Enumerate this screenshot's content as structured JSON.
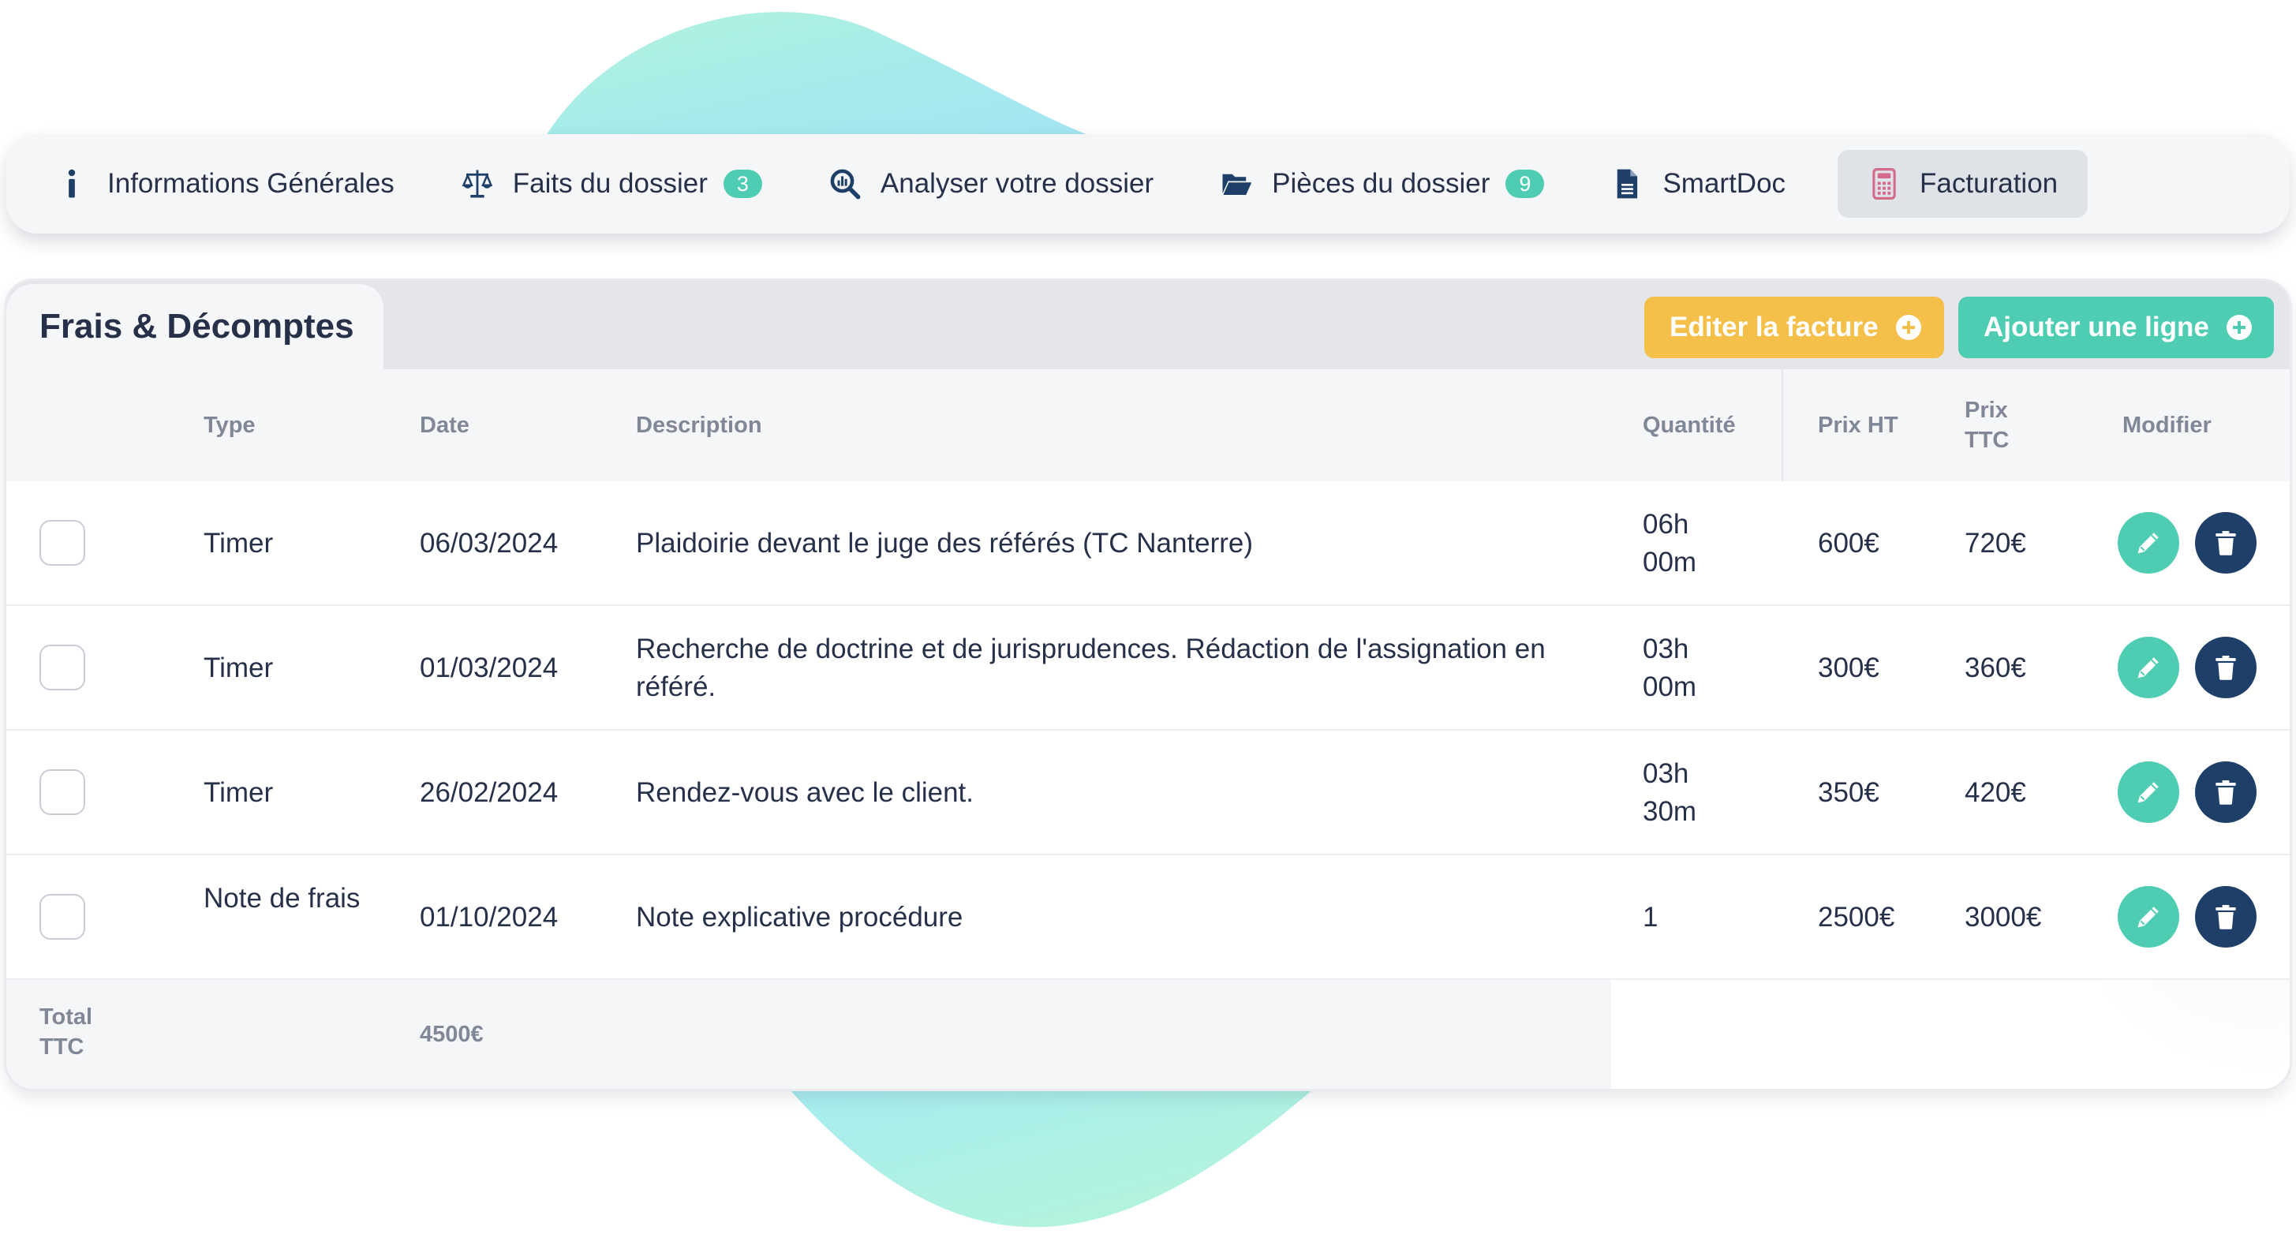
{
  "tabs": [
    {
      "label": "Informations Générales",
      "icon": "info-icon",
      "badge": ""
    },
    {
      "label": "Faits du dossier",
      "icon": "scale-icon",
      "badge": "3"
    },
    {
      "label": "Analyser votre dossier",
      "icon": "search-analytics-icon",
      "badge": ""
    },
    {
      "label": "Pièces du dossier",
      "icon": "folder-open-icon",
      "badge": "9"
    },
    {
      "label": "SmartDoc",
      "icon": "document-icon",
      "badge": ""
    },
    {
      "label": "Facturation",
      "icon": "calculator-icon",
      "badge": "",
      "active": true
    }
  ],
  "card": {
    "title": "Frais & Décomptes",
    "edit_invoice_label": "Editer la facture",
    "add_line_label": "Ajouter une ligne"
  },
  "table": {
    "headers": {
      "type": "Type",
      "date": "Date",
      "description": "Description",
      "quantity": "Quantité",
      "price_ht": "Prix HT",
      "price_ttc_1": "Prix",
      "price_ttc_2": "TTC",
      "modify": "Modifier"
    },
    "rows": [
      {
        "type": "Timer",
        "date": "06/03/2024",
        "description": "Plaidoirie devant le juge des référés (TC Nanterre)",
        "quantity_1": "06h",
        "quantity_2": "00m",
        "price_ht": "600€",
        "price_ttc": "720€"
      },
      {
        "type": "Timer",
        "date": "01/03/2024",
        "description": "Recherche de doctrine et de jurisprudences. Rédaction de l'assignation en référé.",
        "quantity_1": "03h",
        "quantity_2": "00m",
        "price_ht": "300€",
        "price_ttc": "360€"
      },
      {
        "type": "Timer",
        "date": "26/02/2024",
        "description": "Rendez-vous avec le client.",
        "quantity_1": "03h",
        "quantity_2": "30m",
        "price_ht": "350€",
        "price_ttc": "420€"
      },
      {
        "type": "Note de frais",
        "date": "01/10/2024",
        "description": "Note explicative procédure",
        "quantity_1": "1",
        "quantity_2": "",
        "price_ht": "2500€",
        "price_ttc": "3000€"
      }
    ],
    "total_label_1": "Total",
    "total_label_2": "TTC",
    "total_value": "4500€"
  },
  "colors": {
    "accent_teal": "#4ecdb2",
    "accent_yellow": "#f4c04a",
    "navy": "#1e3f68",
    "text": "#263048",
    "muted": "#808797"
  }
}
